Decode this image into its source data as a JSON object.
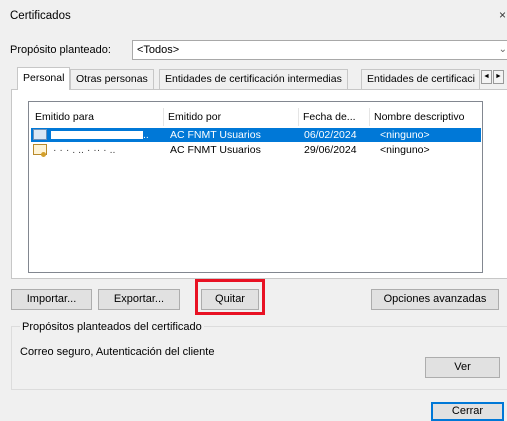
{
  "window": {
    "title": "Certificados",
    "close_glyph": "×"
  },
  "purpose": {
    "label": "Propósito planteado:",
    "value": "<Todos>",
    "arrow": "⌄"
  },
  "tabs": [
    {
      "label": "Personal",
      "active": true
    },
    {
      "label": "Otras personas"
    },
    {
      "label": "Entidades de certificación intermedias"
    },
    {
      "label": "Entidades de certificaci"
    }
  ],
  "tab_scroll": {
    "left": "◄",
    "right": "►"
  },
  "table": {
    "columns": [
      "Emitido para",
      "Emitido por",
      "Fecha de...",
      "Nombre descriptivo"
    ],
    "rows": [
      {
        "issued_to": "..",
        "issued_by": "AC FNMT Usuarios",
        "date": "06/02/2024",
        "friendly_name": "<ninguno>",
        "selected": true
      },
      {
        "issued_to": "· ·  ·  . ..   · ·· ·  ..",
        "issued_by": "AC FNMT Usuarios",
        "date": "29/06/2024",
        "friendly_name": "<ninguno>",
        "selected": false
      }
    ]
  },
  "buttons": {
    "import": "Importar...",
    "export": "Exportar...",
    "remove": "Quitar",
    "advanced": "Opciones avanzadas",
    "view": "Ver",
    "close": "Cerrar"
  },
  "purposes_group": {
    "legend": "Propósitos planteados del certificado",
    "text": "Correo seguro, Autenticación del cliente"
  },
  "colors": {
    "selection": "#0078d7",
    "highlight": "#e81123"
  }
}
